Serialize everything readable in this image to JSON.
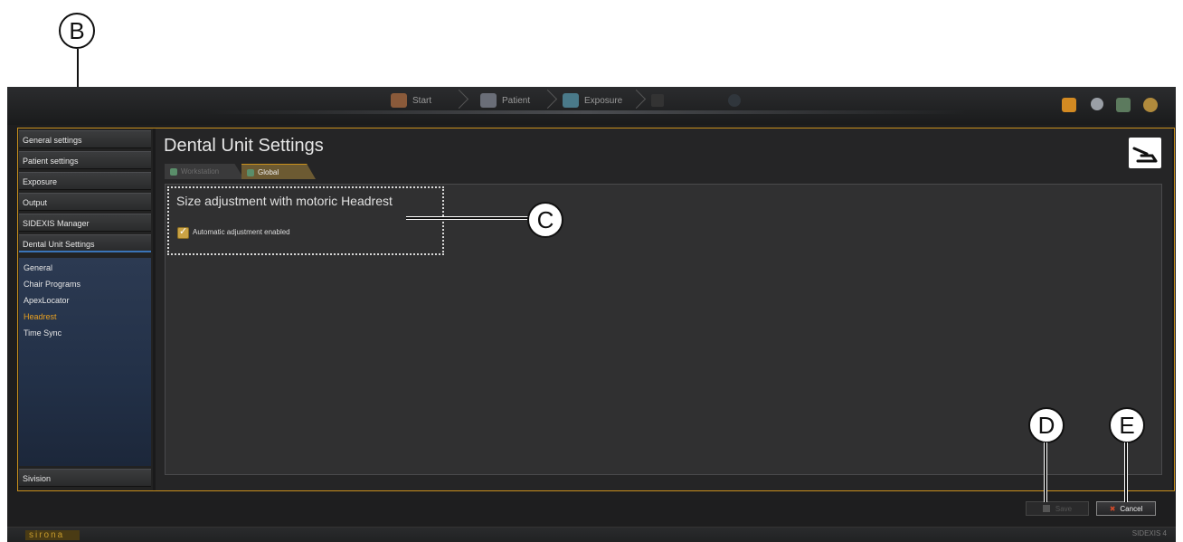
{
  "callouts": {
    "b": "B",
    "c": "C",
    "d": "D",
    "e": "E"
  },
  "workflow": {
    "start": "Start",
    "patient": "Patient",
    "exposure": "Exposure"
  },
  "sidebar": {
    "items": [
      {
        "label": "General settings"
      },
      {
        "label": "Patient settings"
      },
      {
        "label": "Exposure"
      },
      {
        "label": "Output"
      },
      {
        "label": "SIDEXIS Manager"
      },
      {
        "label": "Dental Unit Settings"
      }
    ],
    "subitems": [
      {
        "label": "General"
      },
      {
        "label": "Chair Programs"
      },
      {
        "label": "ApexLocator"
      },
      {
        "label": "Headrest"
      },
      {
        "label": "Time Sync"
      }
    ],
    "bottom": "Sivision"
  },
  "page": {
    "title": "Dental Unit Settings",
    "tabs": [
      {
        "label": "Workstation"
      },
      {
        "label": "Global"
      }
    ],
    "group_title": "Size adjustment with motoric Headrest",
    "checkbox_label": "Automatic adjustment enabled",
    "checkbox_checked": true
  },
  "buttons": {
    "save": "Save",
    "cancel": "Cancel"
  },
  "status": {
    "brand": "sirona",
    "version": "SIDEXIS 4"
  },
  "colors": {
    "accent": "#c9901c",
    "selected": "#e8a020",
    "active_underline": "#3a74b8"
  }
}
